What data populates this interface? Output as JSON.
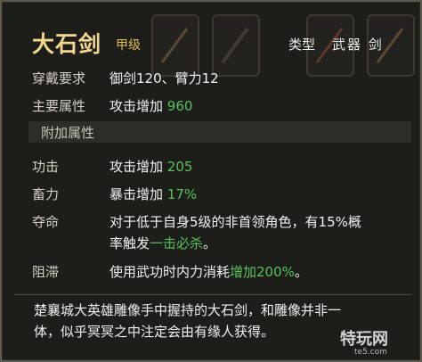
{
  "item": {
    "name": "大石剑",
    "grade": "甲级",
    "type_label": "类型",
    "type_value": "武器 剑"
  },
  "stats": {
    "requirement_label": "穿戴要求",
    "requirement_value": "御剑120、臂力12",
    "main_attr_label": "主要属性",
    "main_attr_text": "攻击增加",
    "main_attr_num": "960"
  },
  "extra": {
    "section_title": "附加属性",
    "rows": [
      {
        "label": "功击",
        "text": "攻击增加",
        "num": "205"
      },
      {
        "label": "畜力",
        "text": "暴击增加",
        "num": "17%"
      }
    ],
    "duoming_label": "夺命",
    "duoming_line1": "对于低于自身5级的非首领角色，有15%概",
    "duoming_line2_pre": "率触发",
    "duoming_line2_green": "一击必杀",
    "duoming_line2_post": "。",
    "zuzhi_label": "阻滞",
    "zuzhi_pre": "使用武功时内力消耗",
    "zuzhi_green": "增加200%",
    "zuzhi_post": "。"
  },
  "description": {
    "line1": "楚襄城大英雄雕像手中握持的大石剑，和雕像并非一",
    "line2": "体，似乎冥冥之中注定会由有缘人获得。"
  },
  "watermark": {
    "main": "特玩网",
    "sub": "te5.com"
  },
  "colors": {
    "title": "#f0d98f",
    "grade": "#e0bc54",
    "green": "#58c25a",
    "text": "#f2f2f2"
  }
}
